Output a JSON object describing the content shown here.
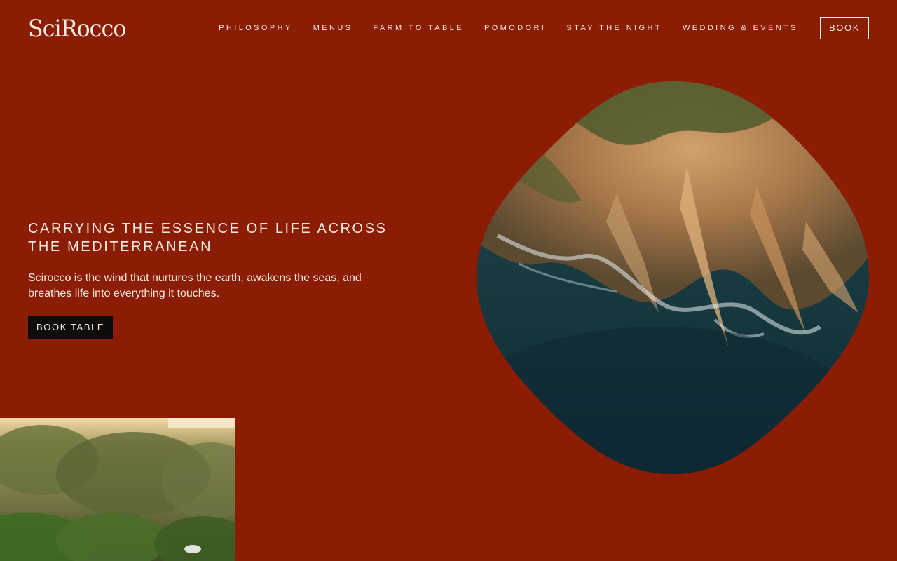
{
  "brand": {
    "logo_text": "SciRocco",
    "background_color": "#8a1d03",
    "text_color": "#f6ebe2"
  },
  "nav": {
    "items": [
      {
        "label": "PHILOSOPHY"
      },
      {
        "label": "MENUS"
      },
      {
        "label": "FARM TO TABLE"
      },
      {
        "label": "POMODORI"
      },
      {
        "label": "STAY THE NIGHT"
      },
      {
        "label": "WEDDING & EVENTS"
      }
    ],
    "book_label": "BOOK"
  },
  "hero": {
    "title": "CARRYING THE ESSENCE OF LIFE ACROSS THE MEDITERRANEAN",
    "text": "Scirocco is the wind that nurtures the earth, awakens the seas, and breathes life into everything it touches.",
    "cta_label": "BOOK TABLE"
  },
  "images": {
    "hero_image": "aerial-coastline-photo",
    "secondary_image": "sunlit-forest-photo"
  }
}
